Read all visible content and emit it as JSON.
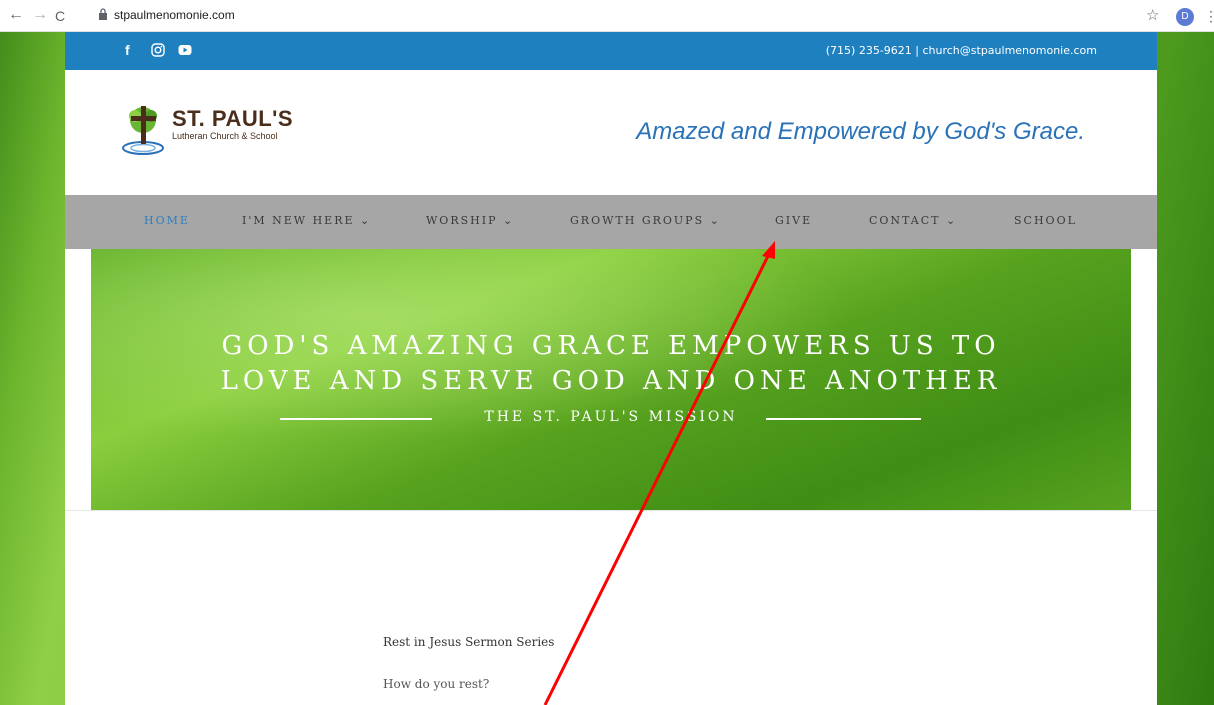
{
  "browser": {
    "url": "stpaulmenomonie.com",
    "profile_initial": "D",
    "back_glyph": "←",
    "forward_glyph": "→",
    "reload_glyph": "C",
    "star_glyph": "☆",
    "menu_glyph": "⋮"
  },
  "topbar": {
    "social_icons": [
      "facebook-icon",
      "instagram-icon",
      "youtube-icon"
    ],
    "facebook_glyph": "f",
    "contact": "(715) 235-9621  |  church@stpaulmenomonie.com"
  },
  "header": {
    "logo_name": "ST. PAUL'S",
    "logo_sub": "Lutheran Church & School",
    "tagline": "Amazed and Empowered by God's Grace."
  },
  "nav": {
    "items": [
      {
        "label": "HOME",
        "active": true
      },
      {
        "label": "I'M NEW HERE ⌄"
      },
      {
        "label": "WORSHIP ⌄"
      },
      {
        "label": "GROWTH GROUPS ⌄"
      },
      {
        "label": "GIVE"
      },
      {
        "label": "CONTACT ⌄"
      },
      {
        "label": "SCHOOL"
      }
    ]
  },
  "hero": {
    "line1": "GOD'S AMAZING GRACE EMPOWERS US TO",
    "line2": "LOVE AND SERVE GOD AND ONE ANOTHER",
    "mission": "THE ST. PAUL'S MISSION"
  },
  "content": {
    "post_title": "Rest in Jesus Sermon Series",
    "post_sub": "How do you rest?"
  },
  "colors": {
    "topbar": "#1f80c0",
    "nav_bg": "#a6a6a6",
    "nav_active": "#2f7fc2",
    "tagline": "#2a72b8",
    "annotation_arrow": "#ff0000",
    "profile": "#5b7bd5"
  }
}
